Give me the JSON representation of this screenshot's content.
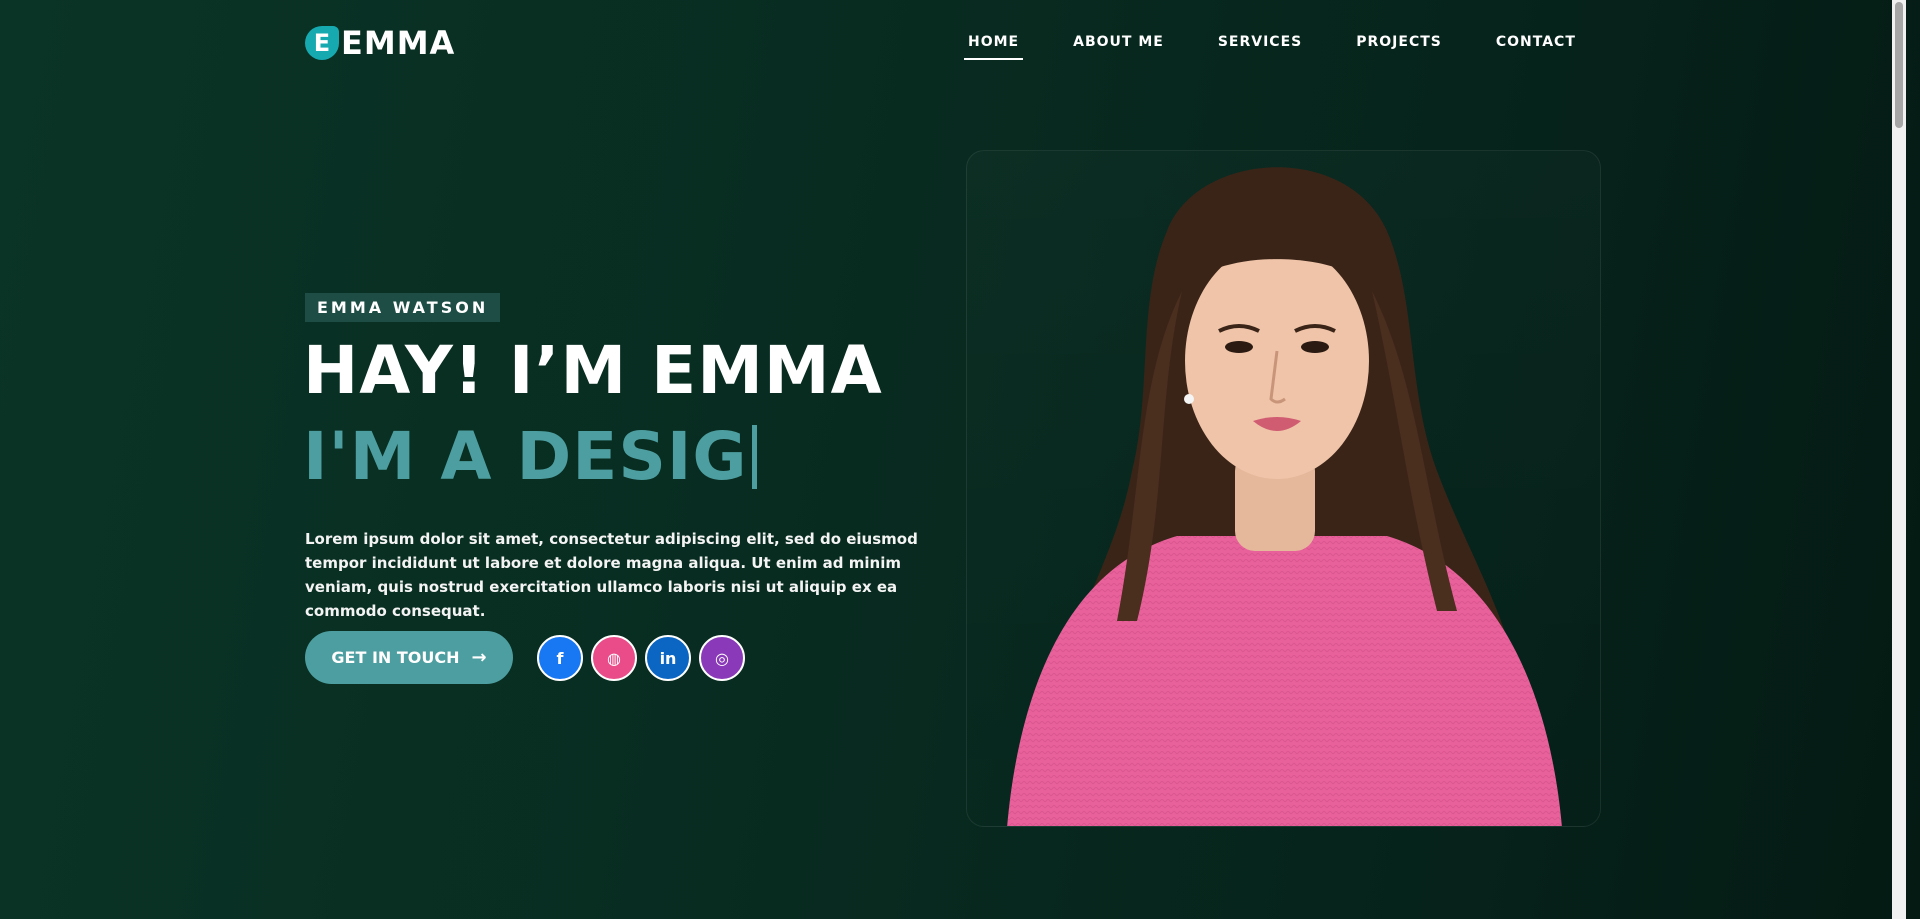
{
  "brand": {
    "logo_letter": "E",
    "logo_text": "EMMA"
  },
  "nav": {
    "items": [
      {
        "label": "HOME",
        "active": true
      },
      {
        "label": "ABOUT ME",
        "active": false
      },
      {
        "label": "SERVICES",
        "active": false
      },
      {
        "label": "PROJECTS",
        "active": false
      },
      {
        "label": "CONTACT",
        "active": false
      }
    ]
  },
  "hero": {
    "tag": "EMMA WATSON",
    "title": "HAY! I’M EMMA",
    "typed": "I'M A DESIG",
    "description": "Lorem ipsum dolor sit amet, consectetur adipiscing elit, sed do eiusmod tempor incididunt ut labore et dolore magna aliqua. Ut enim ad minim veniam, quis nostrud exercitation ullamco laboris nisi ut aliquip ex ea commodo consequat.",
    "cta_label": "GET IN TOUCH",
    "socials": [
      {
        "icon": "facebook-icon",
        "glyph": "f"
      },
      {
        "icon": "dribbble-icon",
        "glyph": "◍"
      },
      {
        "icon": "linkedin-icon",
        "glyph": "in"
      },
      {
        "icon": "instagram-icon",
        "glyph": "◎"
      }
    ]
  },
  "colors": {
    "background": "#082b20",
    "accent": "#4d9ea0",
    "logo": "#16a9b0",
    "tag_bg": "#1d4d44",
    "sweater": "#e8619b"
  }
}
